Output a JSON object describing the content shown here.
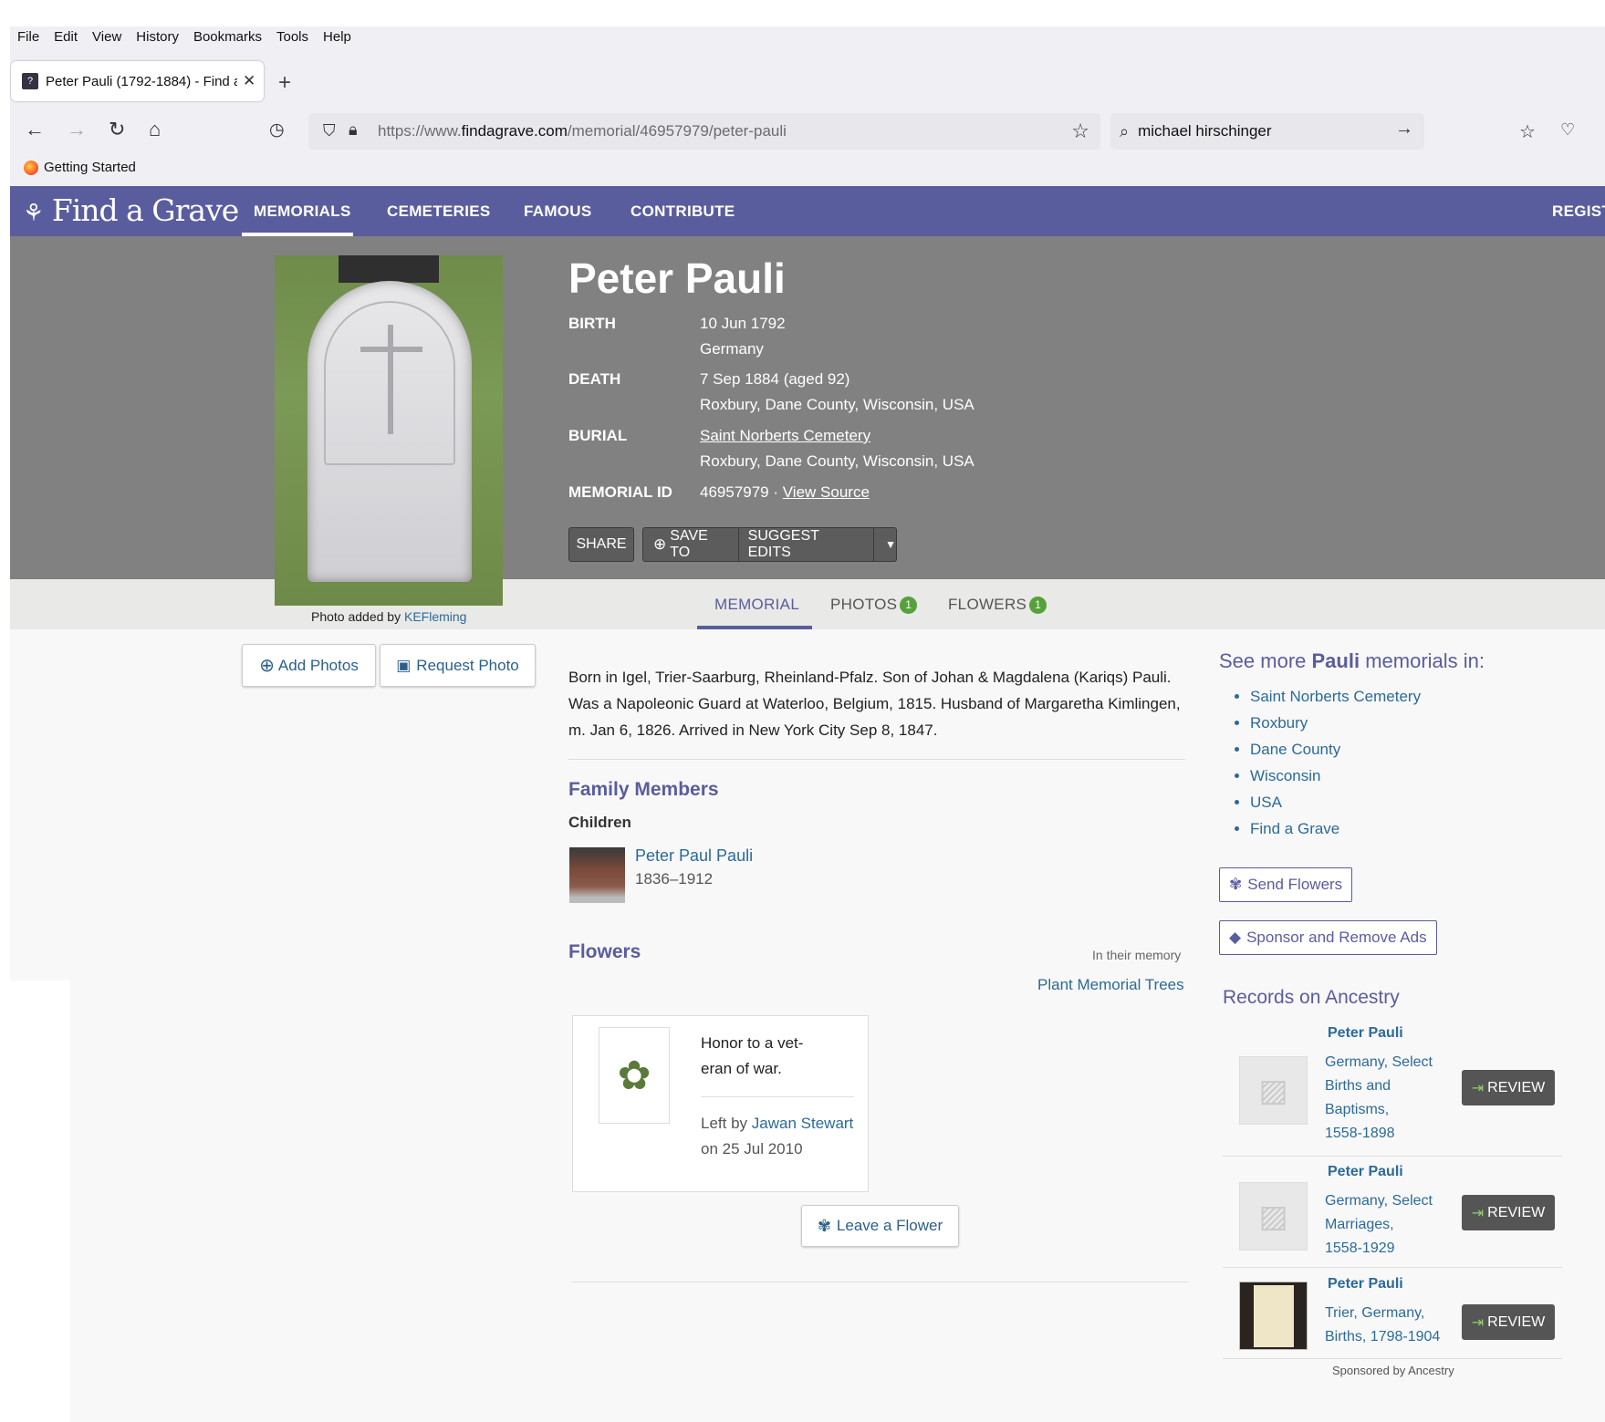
{
  "browser": {
    "menu": [
      "File",
      "Edit",
      "View",
      "History",
      "Bookmarks",
      "Tools",
      "Help"
    ],
    "tab_title": "Peter Pauli (1792-1884) - Find a",
    "url_prefix": "https://www.",
    "url_domain": "findagrave.com",
    "url_path": "/memorial/46957979/peter-pauli",
    "search_value": "michael hirschinger",
    "bookmark": "Getting Started"
  },
  "site": {
    "logo": "Find a Grave",
    "nav": [
      "MEMORIALS",
      "CEMETERIES",
      "FAMOUS",
      "CONTRIBUTE"
    ],
    "register": "REGIST"
  },
  "memorial": {
    "name": "Peter Pauli",
    "birth_label": "BIRTH",
    "birth_date": "10 Jun 1792",
    "birth_place": "Germany",
    "death_label": "DEATH",
    "death_date": "7 Sep 1884 (aged 92)",
    "death_place": "Roxbury, Dane County, Wisconsin, USA",
    "burial_label": "BURIAL",
    "burial_cemetery": "Saint Norberts Cemetery",
    "burial_place": "Roxbury, Dane County, Wisconsin, USA",
    "id_label": "MEMORIAL ID",
    "id_value": "46957979 ·",
    "view_source": "View Source",
    "buttons": {
      "share": "SHARE",
      "save": "SAVE TO",
      "suggest": "SUGGEST EDITS"
    },
    "photo_caption_prefix": "Photo added by",
    "photo_caption_user": "KEFleming"
  },
  "tabs": {
    "memorial": "MEMORIAL",
    "photos": "PHOTOS",
    "photos_count": "1",
    "flowers": "FLOWERS",
    "flowers_count": "1"
  },
  "actions": {
    "add_photos": "Add Photos",
    "request_photo": "Request Photo"
  },
  "bio": "Born in Igel, Trier-Saarburg, Rheinland-Pfalz. Son of Johan & Magdalena (Kariqs) Pauli. Was a Napoleonic Guard at Waterloo, Belgium, 1815. Husband of Margaretha Kimlingen, m. Jan 6, 1826. Arrived in New York City Sep 8, 1847.",
  "family": {
    "heading": "Family Members",
    "children_label": "Children",
    "child_name": "Peter Paul Pauli",
    "child_dates": "1836–1912"
  },
  "flowers": {
    "heading": "Flowers",
    "in_memory": "In their memory",
    "plant_trees": "Plant Memorial Trees",
    "note_line1": "Honor to a vet-",
    "note_line2": "eran of war.",
    "left_by": "Left by",
    "left_by_user": "Jawan Stewart",
    "left_on": "on 25 Jul 2010",
    "leave_flower": "Leave a Flower"
  },
  "sidebar": {
    "heading_pre": "See more ",
    "heading_name": "Pauli",
    "heading_post": " memorials in:",
    "links": [
      "Saint Norberts Cemetery",
      "Roxbury",
      "Dane County",
      "Wisconsin",
      "USA",
      "Find a Grave"
    ],
    "send_flowers": "Send Flowers",
    "sponsor": "Sponsor and Remove Ads",
    "records_heading": "Records on Ancestry",
    "records": [
      {
        "name": "Peter Pauli",
        "lines": [
          "Germany, Select",
          "Births and",
          "Baptisms,",
          "1558-1898"
        ]
      },
      {
        "name": "Peter Pauli",
        "lines": [
          "Germany, Select",
          "Marriages,",
          "1558-1929"
        ]
      },
      {
        "name": "Peter Pauli",
        "lines": [
          "Trier, Germany,",
          "Births, 1798-1904"
        ]
      }
    ],
    "review": "REVIEW",
    "sponsored": "Sponsored by Ancestry"
  }
}
